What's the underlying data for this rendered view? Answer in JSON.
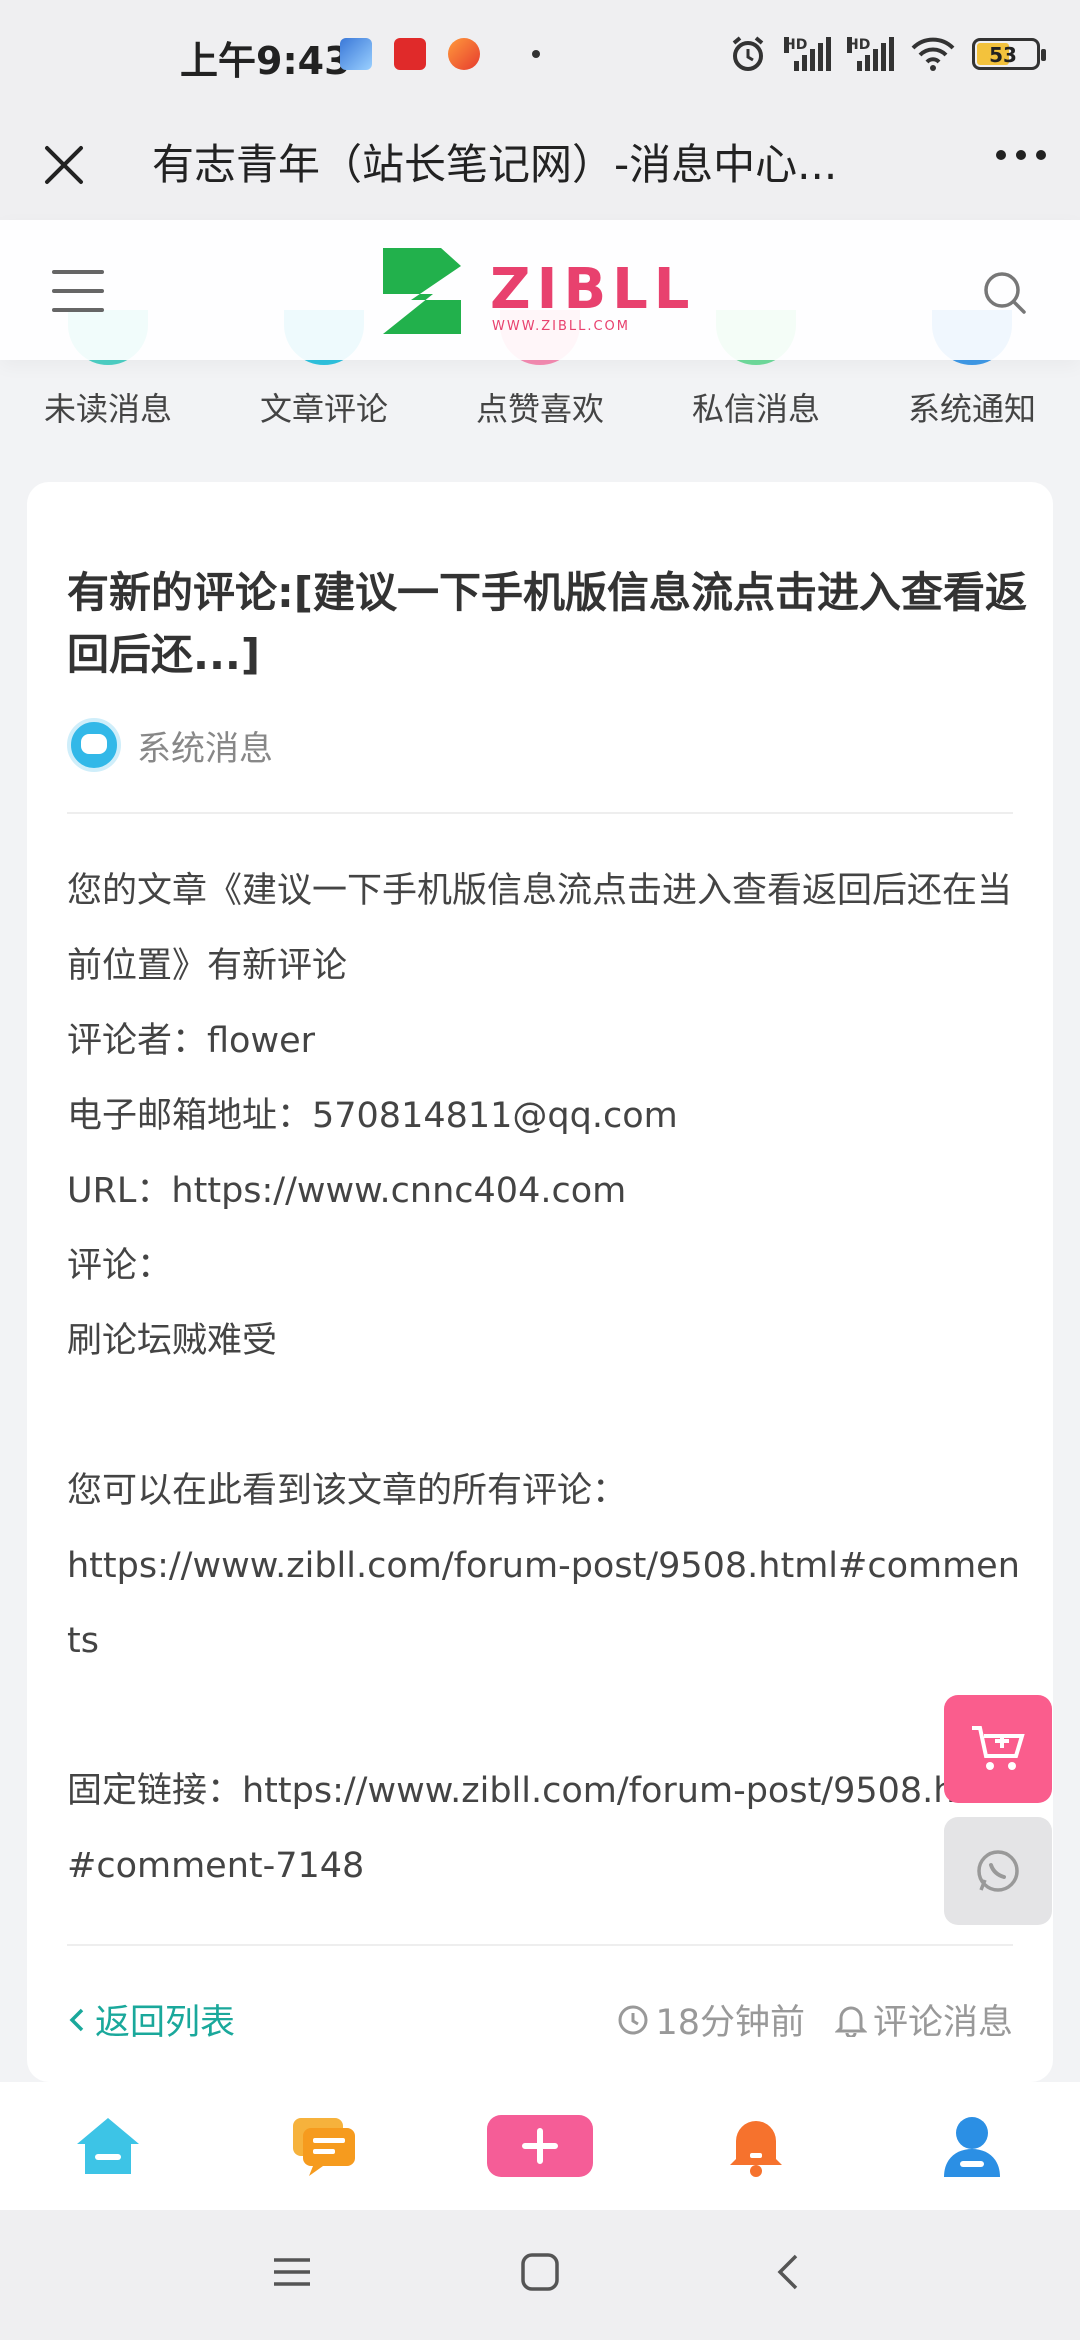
{
  "status_bar": {
    "time": "上午9:43",
    "battery": "53",
    "hd_label": "HD"
  },
  "titlebar": {
    "title": "有志青年（站长笔记网）-消息中心..."
  },
  "site": {
    "logo_text": "ZIBLL",
    "logo_subtext": "WWW.ZIBLL.COM",
    "colors": {
      "brand_green": "#22b14c",
      "brand_pink": "#e8416e"
    }
  },
  "categories": [
    {
      "label": "未读消息",
      "color": "#4dd0c5"
    },
    {
      "label": "文章评论",
      "color": "#2fc3e0"
    },
    {
      "label": "点赞喜欢",
      "color": "#f58bb2"
    },
    {
      "label": "私信消息",
      "color": "#6fdc9c"
    },
    {
      "label": "系统通知",
      "color": "#3f9ae8"
    }
  ],
  "message": {
    "title": "有新的评论:[建议一下手机版信息流点击进入查看返回后还...]",
    "sender": "系统消息",
    "body_lines": [
      "您的文章《建议一下手机版信息流点击进入查看返回后还在当前位置》有新评论",
      "评论者：flower",
      "电子邮箱地址：570814811@qq.com",
      "URL：https://www.cnnc404.com",
      "评论：",
      "刷论坛贼难受",
      "",
      "您可以在此看到该文章的所有评论：",
      "https://www.zibll.com/forum-post/9508.html#comments",
      "",
      "固定链接：https://www.zibll.com/forum-post/9508.html#comment-7148"
    ],
    "back_label": "返回列表",
    "time_ago": "18分钟前",
    "type_label": "评论消息"
  },
  "colors": {
    "accent_teal": "#1aa89b",
    "cart_pink": "#fa5d8d"
  }
}
